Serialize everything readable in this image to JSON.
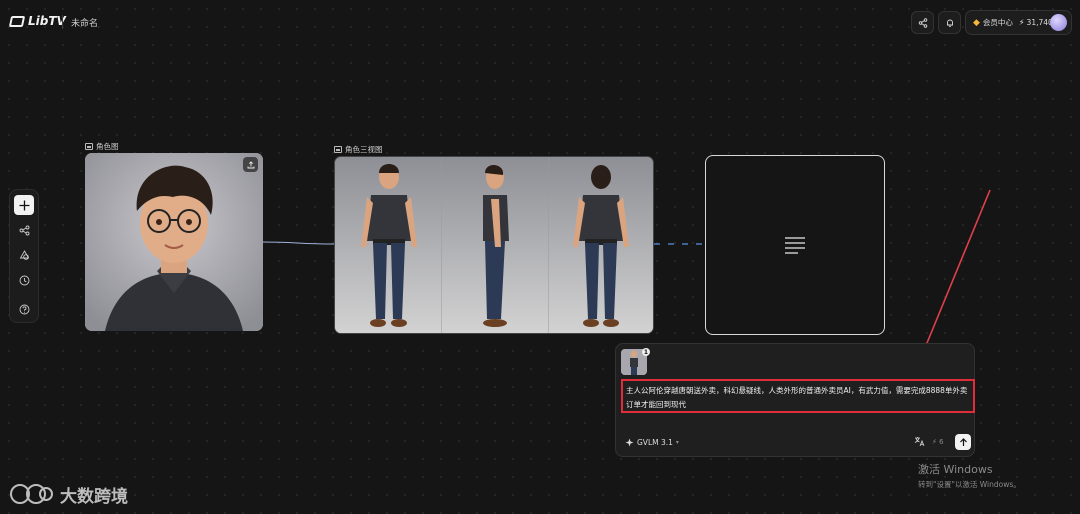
{
  "app": {
    "name": "LibTV",
    "project_title": "未命名"
  },
  "header": {
    "member_label": "会员中心",
    "credits": "31,740"
  },
  "canvas": {
    "nodes": {
      "portrait": {
        "label": "角色图"
      },
      "threeview": {
        "label": "角色三视图"
      }
    }
  },
  "prompt_panel": {
    "ref_count": "1",
    "prompt_text": "主人公阿伦穿越唐朝送外卖，科幻悬疑线，人类外形的普通外卖员AI，有武力值，需要完成8888单外卖订单才能回到现代",
    "model": "GVLM 3.1",
    "cost": "6"
  },
  "overlays": {
    "windows_activation_title": "激活 Windows",
    "windows_activation_sub": "转到\"设置\"以激活 Windows。",
    "brand_watermark": "大数跨境"
  },
  "colors": {
    "highlight_box": "#e02d3a",
    "arrow": "#e0404a",
    "edge": "#9fb3d9"
  }
}
